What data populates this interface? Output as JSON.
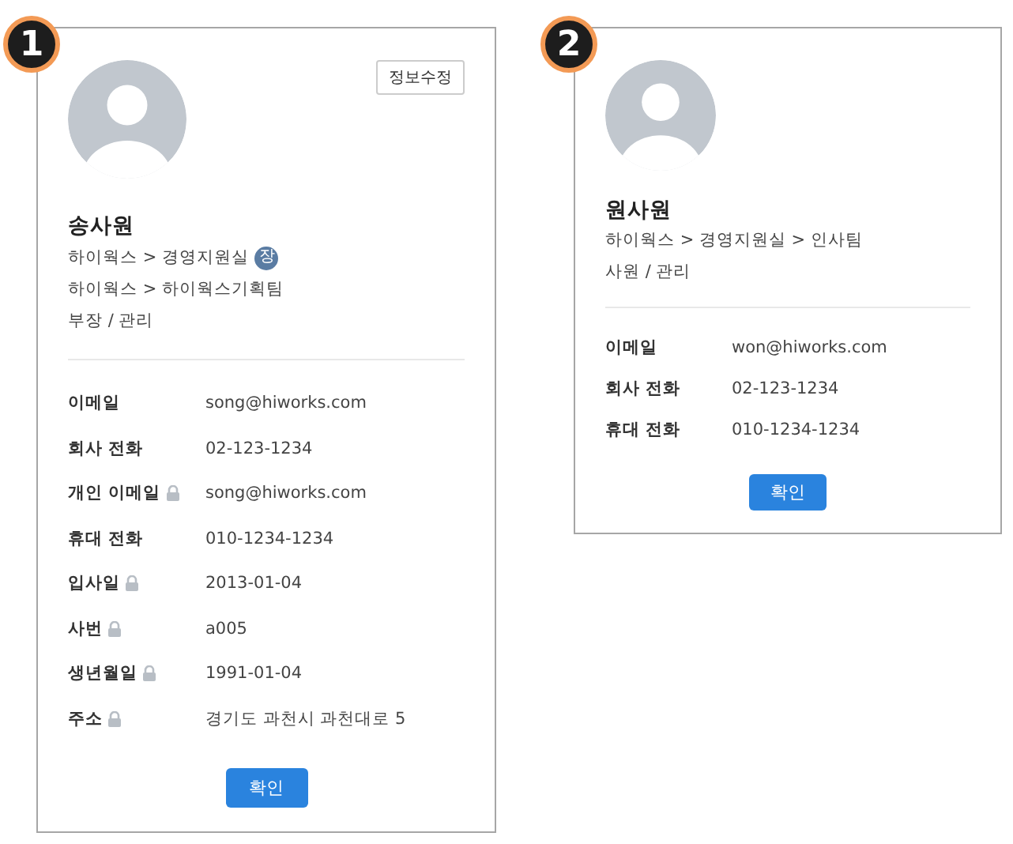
{
  "cards": [
    {
      "number": "1",
      "edit_button": "정보수정",
      "name": "송사원",
      "org_lines": [
        {
          "text": "하이웍스 > 경영지원실",
          "badge": "장"
        },
        {
          "text": "하이웍스 > 하이웍스기획팀"
        }
      ],
      "role": "부장 / 관리",
      "fields": [
        {
          "label": "이메일",
          "value": "song@hiworks.com",
          "locked": false
        },
        {
          "label": "회사 전화",
          "value": "02-123-1234",
          "locked": false
        },
        {
          "label": "개인 이메일",
          "value": "song@hiworks.com",
          "locked": true
        },
        {
          "label": "휴대 전화",
          "value": "010-1234-1234",
          "locked": false
        },
        {
          "label": "입사일",
          "value": "2013-01-04",
          "locked": true
        },
        {
          "label": "사번",
          "value": "a005",
          "locked": true
        },
        {
          "label": "생년월일",
          "value": "1991-01-04",
          "locked": true
        },
        {
          "label": "주소",
          "value": "경기도 과천시 과천대로 5",
          "locked": true
        }
      ],
      "confirm_button": "확인"
    },
    {
      "number": "2",
      "name": "원사원",
      "org_lines": [
        {
          "text": "하이웍스 > 경영지원실 > 인사팀"
        }
      ],
      "role": "사원 / 관리",
      "fields": [
        {
          "label": "이메일",
          "value": "won@hiworks.com",
          "locked": false
        },
        {
          "label": "회사 전화",
          "value": "02-123-1234",
          "locked": false
        },
        {
          "label": "휴대 전화",
          "value": "010-1234-1234",
          "locked": false
        }
      ],
      "confirm_button": "확인"
    }
  ]
}
